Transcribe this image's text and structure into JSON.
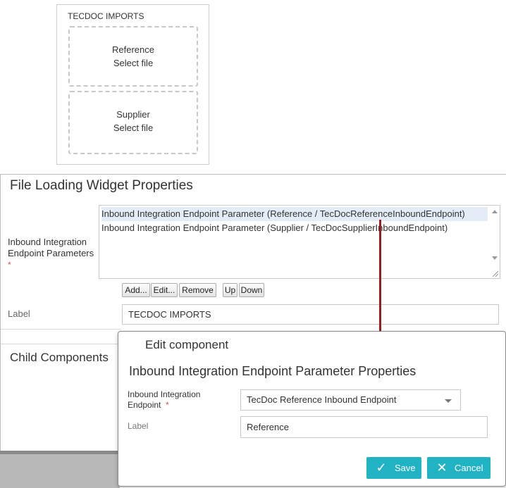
{
  "preview": {
    "title": "TECDOC IMPORTS",
    "slots": [
      {
        "name": "Reference",
        "action": "Select file"
      },
      {
        "name": "Supplier",
        "action": "Select file"
      }
    ]
  },
  "props": {
    "title": "File Loading Widget Properties",
    "endpoints_label": "Inbound Integration Endpoint Parameters",
    "required_marker": "*",
    "endpoints": [
      "Inbound Integration Endpoint Parameter (Reference / TecDocReferenceInboundEndpoint)",
      "Inbound Integration Endpoint Parameter (Supplier / TecDocSupplierInboundEndpoint)"
    ],
    "buttons": {
      "add": "Add...",
      "edit": "Edit...",
      "remove": "Remove",
      "up": "Up",
      "down": "Down"
    },
    "label_caption": "Label",
    "label_value": "TECDOC IMPORTS",
    "child_components": "Child Components"
  },
  "dialog": {
    "title": "Edit component",
    "subtitle": "Inbound Integration Endpoint Parameter Properties",
    "endpoint_label": "Inbound Integration Endpoint",
    "required_marker": "*",
    "endpoint_value": "TecDoc Reference Inbound Endpoint",
    "label_caption": "Label",
    "label_value": "Reference",
    "save": "Save",
    "cancel": "Cancel"
  },
  "colors": {
    "accent": "#21b3c3",
    "arrow": "#9b1d1d",
    "required": "#d9534f"
  }
}
